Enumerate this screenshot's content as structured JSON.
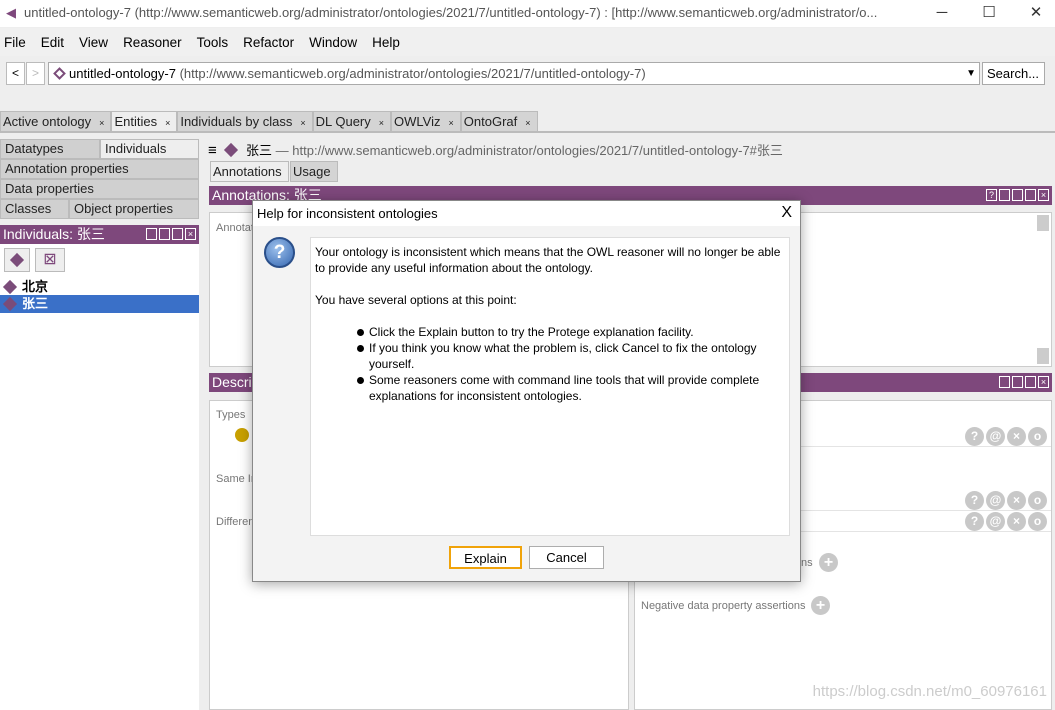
{
  "window": {
    "title": "untitled-ontology-7 (http://www.semanticweb.org/administrator/ontologies/2021/7/untitled-ontology-7)  : [http://www.semanticweb.org/administrator/o...",
    "controls": [
      "minimize",
      "maximize",
      "close"
    ]
  },
  "menu": [
    "File",
    "Edit",
    "View",
    "Reasoner",
    "Tools",
    "Refactor",
    "Window",
    "Help"
  ],
  "nav": {
    "back": "<",
    "forward": ">",
    "ontology_name": "untitled-ontology-7",
    "ontology_iri": "(http://www.semanticweb.org/administrator/ontologies/2021/7/untitled-ontology-7)",
    "search_label": "Search..."
  },
  "tabs": [
    {
      "label": "Active ontology"
    },
    {
      "label": "Entities",
      "active": true
    },
    {
      "label": "Individuals by class"
    },
    {
      "label": "DL Query"
    },
    {
      "label": "OWLViz"
    },
    {
      "label": "OntoGraf"
    }
  ],
  "left": {
    "tabs": [
      "Datatypes",
      "Individuals",
      "Annotation properties",
      "Data properties",
      "Classes",
      "Object properties"
    ],
    "header": "Individuals: 张三",
    "items": [
      {
        "label": "北京"
      },
      {
        "label": "张三",
        "selected": true
      }
    ]
  },
  "entity": {
    "name": "张三",
    "iri": "— http://www.semanticweb.org/administrator/ontologies/2021/7/untitled-ontology-7#张三",
    "subtabs": [
      "Annotations",
      "Usage"
    ],
    "annotations_header": "Annotations: 张三",
    "annotations_label": "Annotat",
    "description_header": "Descri",
    "types": "Types",
    "same": "Same In",
    "different": "Differen",
    "partial_assertions": "ns",
    "negative_data": "Negative data property assertions"
  },
  "dialog": {
    "title": "Help for inconsistent ontologies",
    "para1": "Your ontology is inconsistent which means that the OWL reasoner will no longer be able to provide any useful information about the ontology.",
    "para2": "You have several options at this point:",
    "bullets": [
      "Click the Explain button to try the Protege explanation facility.",
      "If you think you know what the problem is, click Cancel to fix the ontology yourself.",
      "Some reasoners come with command line tools that will provide complete explanations for inconsistent ontologies."
    ],
    "explain": "Explain",
    "cancel": "Cancel",
    "close": "X"
  },
  "watermark": "https://blog.csdn.net/m0_60976161",
  "colors": {
    "accent": "#7e487c",
    "selection": "#3a70c8",
    "focus": "#f0a30a"
  }
}
